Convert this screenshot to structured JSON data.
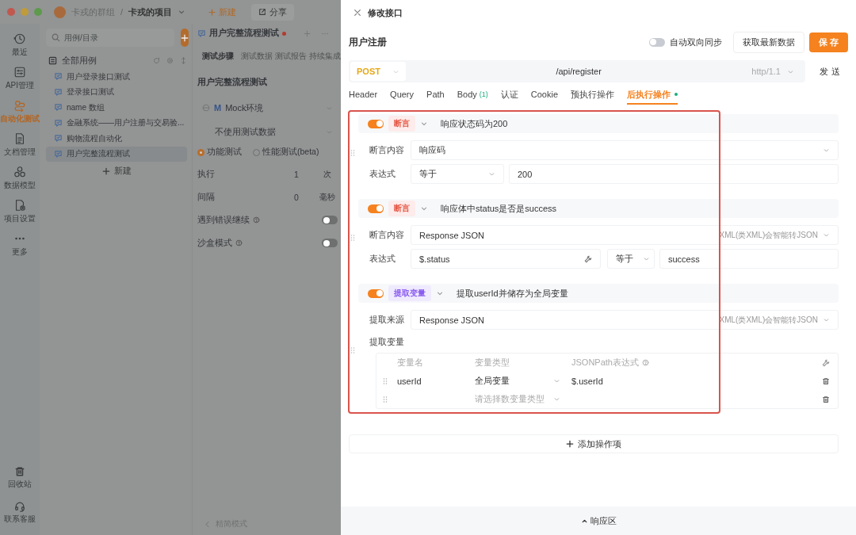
{
  "window": {
    "group": "卡戎的群组",
    "separator": "/",
    "project": "卡戎的项目",
    "new_button": "新建",
    "share_button": "分享"
  },
  "nav_rail": {
    "items": [
      {
        "label": "最近",
        "selected": false
      },
      {
        "label": "API管理",
        "selected": false
      },
      {
        "label": "自动化测试",
        "selected": true
      },
      {
        "label": "文档管理",
        "selected": false
      },
      {
        "label": "数据模型",
        "selected": false
      },
      {
        "label": "项目设置",
        "selected": false
      },
      {
        "label": "更多",
        "selected": false
      }
    ],
    "bottom_items": [
      {
        "label": "回收站"
      },
      {
        "label": "联系客服"
      }
    ]
  },
  "case_list": {
    "search_placeholder": "用例/目录",
    "root": "全部用例",
    "cases": [
      {
        "label": "用户登录接口测试",
        "selected": false
      },
      {
        "label": "登录接口测试",
        "selected": false
      },
      {
        "label": "name 数组",
        "selected": false
      },
      {
        "label": "金融系统——用户注册与交易验...",
        "selected": false
      },
      {
        "label": "购物流程自动化",
        "selected": false
      },
      {
        "label": "用户完整流程测试",
        "selected": true
      }
    ],
    "new_button": "新建"
  },
  "steps_panel": {
    "tab_title": "用户完整流程测试",
    "unsaved": true,
    "tabs": [
      {
        "label": "测试步骤",
        "selected": true
      },
      {
        "label": "测试数据",
        "selected": false
      },
      {
        "label": "测试报告",
        "selected": false
      },
      {
        "label": "持续集成",
        "selected": false
      }
    ],
    "title": "用户完整流程测试",
    "environment": {
      "badge": "M",
      "label": "Mock环境"
    },
    "test_data": "不使用测试数据",
    "modes": [
      {
        "label": "功能测试",
        "selected": true
      },
      {
        "label": "性能测试(beta)",
        "selected": false
      }
    ],
    "settings": [
      {
        "kind": "number",
        "label": "执行",
        "value": "1",
        "unit": "次"
      },
      {
        "kind": "number",
        "label": "间隔",
        "value": "0",
        "unit": "毫秒"
      },
      {
        "kind": "toggle",
        "label": "遇到错误继续",
        "on": false
      },
      {
        "kind": "toggle",
        "label": "沙盒模式",
        "on": false
      }
    ],
    "footer": "精简模式"
  },
  "drawer": {
    "title": "修改接口",
    "name": "用户注册",
    "auto_sync": {
      "label": "自动双向同步",
      "on": false
    },
    "fetch_button": "获取最新数据",
    "save_button": "保 存",
    "request": {
      "method": "POST",
      "url": "/api/register",
      "protocol": "http/1.1",
      "send_button": "发 送"
    },
    "tabs": [
      {
        "label": "Header",
        "selected": false,
        "has_content": false
      },
      {
        "label": "Query",
        "selected": false,
        "has_content": false
      },
      {
        "label": "Path",
        "selected": false,
        "has_content": false
      },
      {
        "label": "Body",
        "count": "(1)",
        "selected": false,
        "has_content": false
      },
      {
        "label": "认证",
        "selected": false,
        "has_content": false
      },
      {
        "label": "Cookie",
        "selected": false,
        "has_content": false
      },
      {
        "label": "预执行操作",
        "selected": false,
        "has_content": false
      },
      {
        "label": "后执行操作",
        "selected": true,
        "has_content": true
      }
    ],
    "operations": [
      {
        "kind": "assertion",
        "enabled": true,
        "tag": "断言",
        "name": "响应状态码为200",
        "source": {
          "label": "断言内容",
          "value": "响应码"
        },
        "expression": {
          "label": "表达式",
          "operator": "等于",
          "value": "200"
        }
      },
      {
        "kind": "assertion",
        "enabled": true,
        "tag": "断言",
        "name": "响应体中status是否是success",
        "source": {
          "label": "断言内容",
          "value": "Response JSON",
          "hint": "XML(类XML)会智能转JSON"
        },
        "expression": {
          "label": "表达式",
          "path": "$.status",
          "operator": "等于",
          "value": "success"
        }
      },
      {
        "kind": "extract",
        "enabled": true,
        "tag": "提取变量",
        "name": "提取userId并储存为全局变量",
        "source": {
          "label": "提取来源",
          "value": "Response JSON",
          "hint": "XML(类XML)会智能转JSON"
        },
        "variables": {
          "label": "提取变量",
          "columns": [
            "变量名",
            "变量类型",
            "JSONPath表达式"
          ],
          "rows": [
            {
              "name": "userId",
              "type": "全局变量",
              "path": "$.userId"
            },
            {
              "type_placeholder": "请选择数变量类型"
            }
          ]
        }
      }
    ],
    "add_button": "添加操作项",
    "response_toggle": "响应区"
  }
}
